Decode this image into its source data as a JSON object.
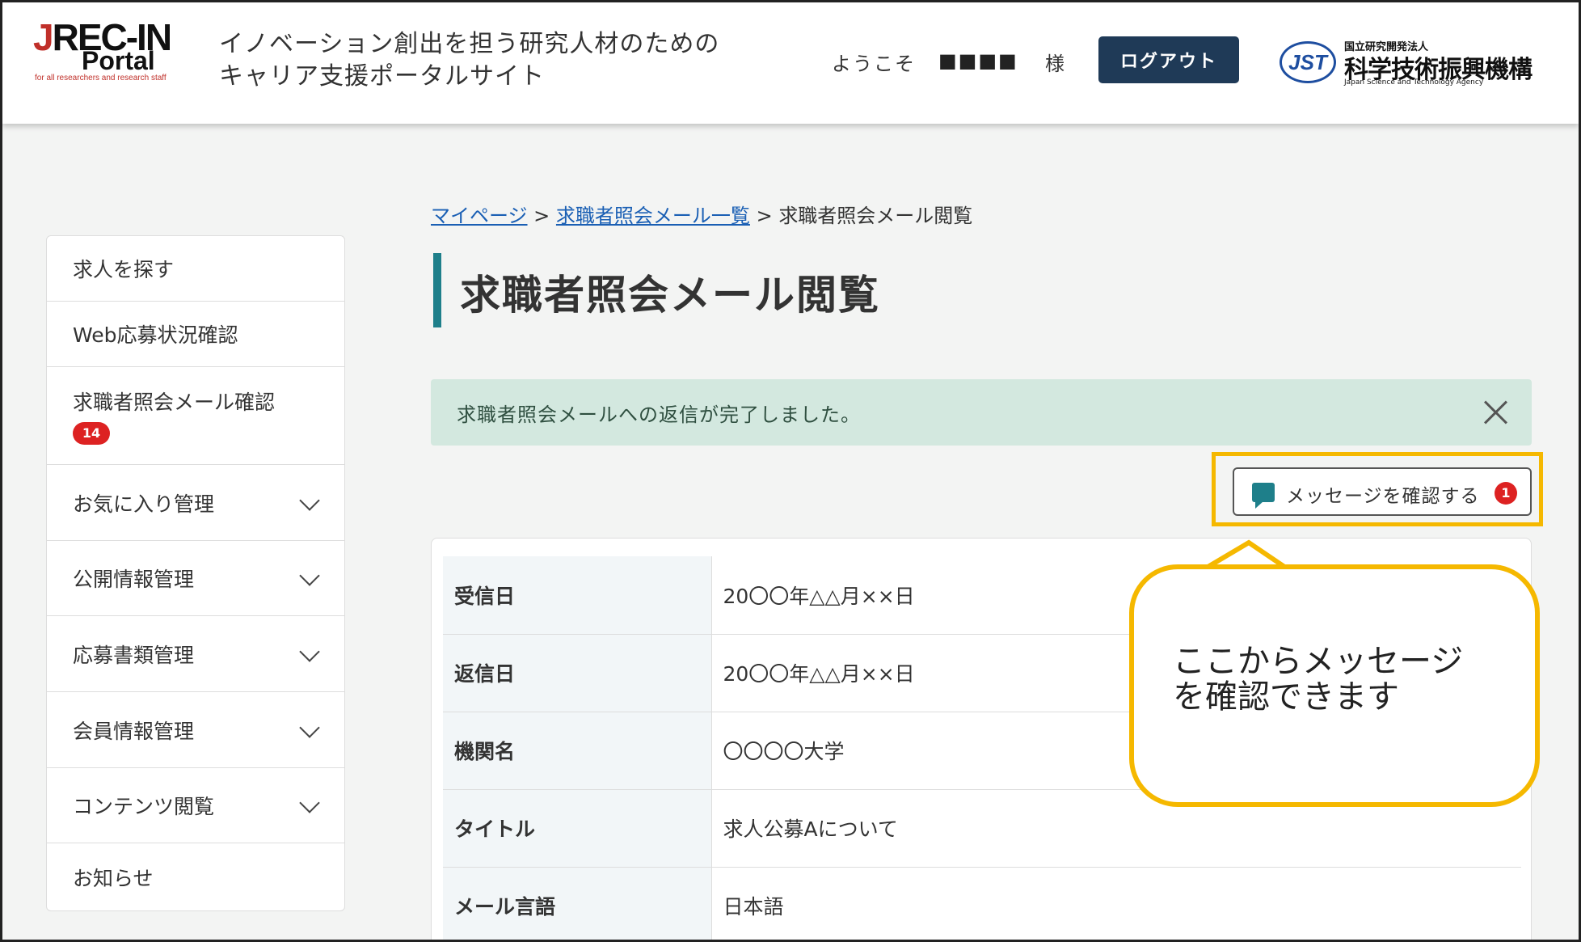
{
  "header": {
    "logo": {
      "line1_j": "J",
      "line1_rest": "REC-IN",
      "line2": "Portal",
      "line3": "for all researchers and research staff"
    },
    "tagline_line1": "イノベーション創出を担う研究人材のための",
    "tagline_line2": "キャリア支援ポータルサイト",
    "welcome": "ようこそ",
    "user_masked": "■■■■",
    "honorific": "様",
    "logout_label": "ログアウト",
    "jst_logo": {
      "badge": "JST",
      "top": "国立研究開発法人",
      "name": "科学技術振興機構",
      "english": "Japan Science and Technology Agency"
    }
  },
  "sidebar": {
    "items": [
      {
        "label": "求人を探す"
      },
      {
        "label": "Web応募状況確認"
      },
      {
        "label": "求職者照会メール確認",
        "badge": "14"
      },
      {
        "label": "お気に入り管理"
      },
      {
        "label": "公開情報管理"
      },
      {
        "label": "応募書類管理"
      },
      {
        "label": "会員情報管理"
      },
      {
        "label": "コンテンツ閲覧"
      },
      {
        "label": "お知らせ"
      }
    ]
  },
  "breadcrumb": {
    "link1": "マイページ",
    "sep": ">",
    "link2": "求職者照会メール一覧",
    "current": "求職者照会メール閲覧"
  },
  "page_title": "求職者照会メール閲覧",
  "alert": {
    "message": "求職者照会メールへの返信が完了しました。"
  },
  "message_button": {
    "label": "メッセージを確認する",
    "count": "1"
  },
  "detail": {
    "rows": [
      {
        "label": "受信日",
        "value": "20〇〇年△△月××日"
      },
      {
        "label": "返信日",
        "value": "20〇〇年△△月××日"
      },
      {
        "label": "機関名",
        "value": "〇〇〇〇大学"
      },
      {
        "label": "タイトル",
        "value": "求人公募Aについて"
      },
      {
        "label": "メール言語",
        "value": "日本語"
      }
    ]
  },
  "callout": {
    "line1": "ここからメッセージ",
    "line2": "を確認できます"
  },
  "colors": {
    "accent": "#1e7f8a",
    "logout_bg": "#1f3a57",
    "highlight": "#f5b800",
    "badge": "#dd2222",
    "alert_bg": "#d3e8df"
  }
}
